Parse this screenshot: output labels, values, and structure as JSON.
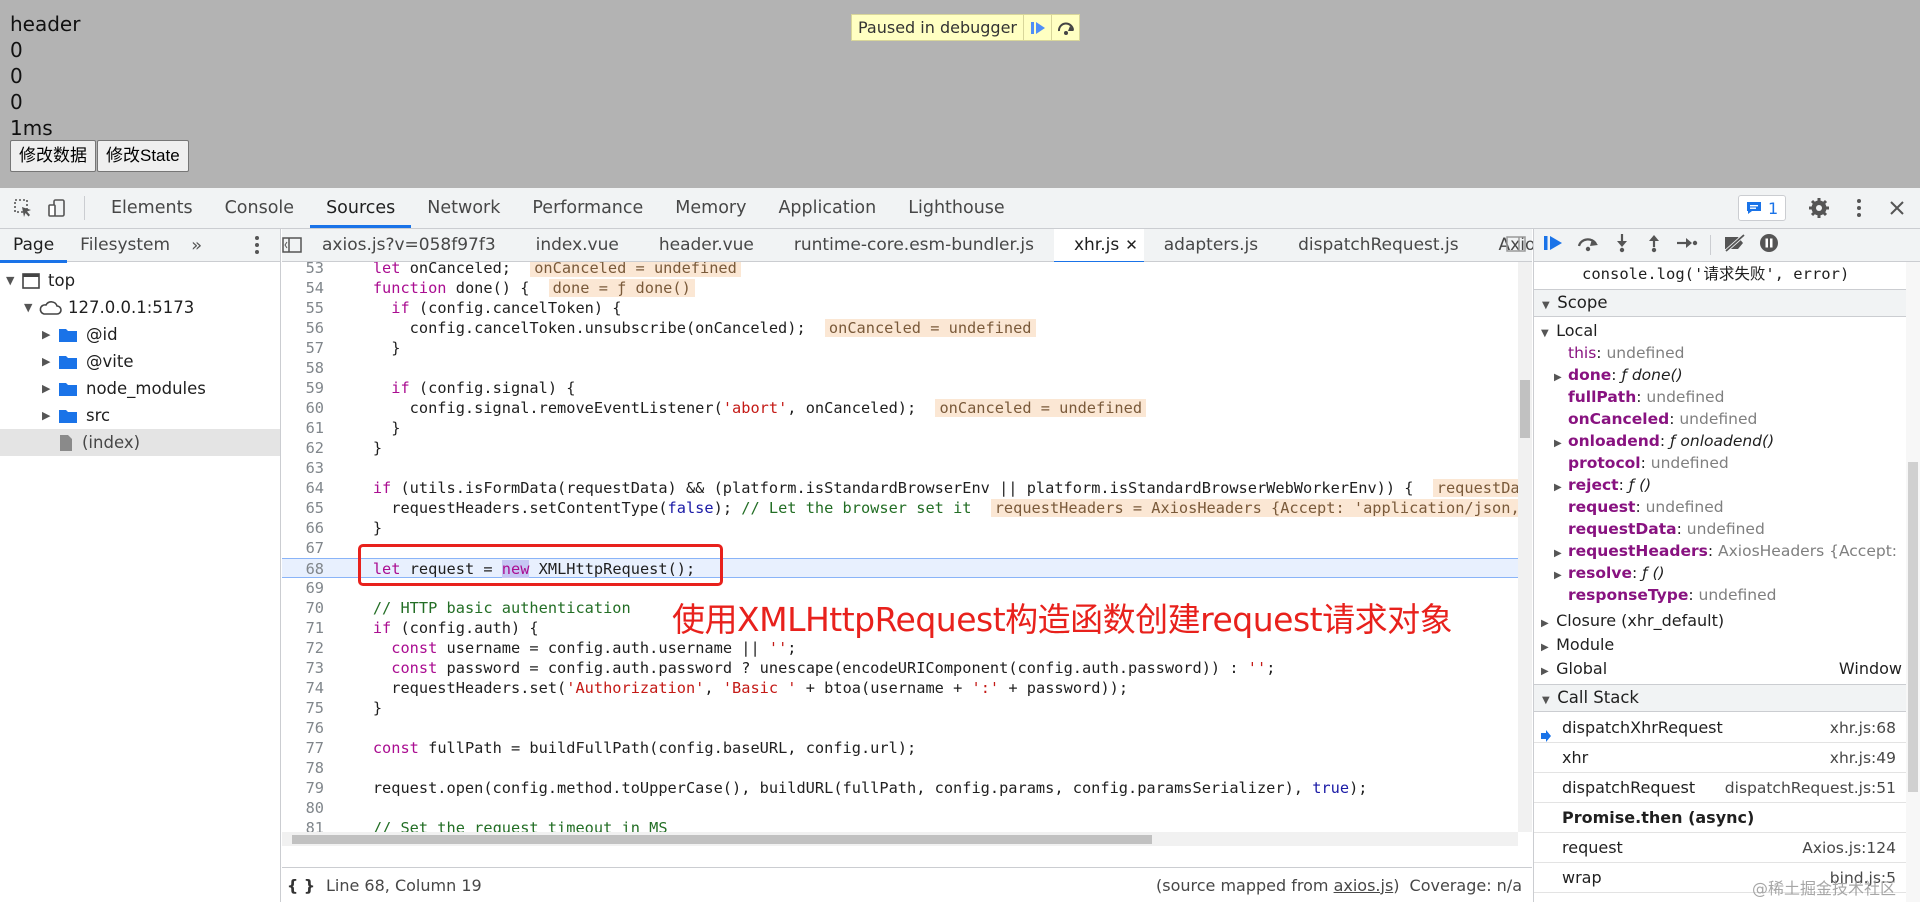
{
  "page": {
    "lines": [
      "header",
      "0",
      "0",
      "0",
      "1ms"
    ],
    "buttons": [
      "修改数据",
      "修改State"
    ],
    "paused_text": "Paused in debugger"
  },
  "devtools": {
    "tabs": [
      "Elements",
      "Console",
      "Sources",
      "Network",
      "Performance",
      "Memory",
      "Application",
      "Lighthouse"
    ],
    "active_tab": "Sources",
    "issues_count": "1"
  },
  "navigator": {
    "tabs": [
      "Page",
      "Filesystem"
    ],
    "tree": [
      {
        "label": "top",
        "type": "frame"
      },
      {
        "label": "127.0.0.1:5173",
        "type": "cloud"
      },
      {
        "label": "@id",
        "type": "folder"
      },
      {
        "label": "@vite",
        "type": "folder"
      },
      {
        "label": "node_modules",
        "type": "folder"
      },
      {
        "label": "src",
        "type": "folder"
      },
      {
        "label": "(index)",
        "type": "file"
      }
    ]
  },
  "editor": {
    "file_tabs": [
      "axios.js?v=058f97f3",
      "index.vue",
      "header.vue",
      "runtime-core.esm-bundler.js",
      "xhr.js",
      "adapters.js",
      "dispatchRequest.js",
      "Axios.js"
    ],
    "active_file": "xhr.js",
    "status": {
      "position": "Line 68, Column 19",
      "source_mapped": "(source mapped from ",
      "source_link": "axios.js",
      "source_close": ")",
      "coverage": "Coverage: n/a"
    },
    "annotation": "使用XMLHttpRequest构造函数创建request请求对象"
  },
  "debugger": {
    "console_line": "console.log('请求失败', error)",
    "scope_title": "Scope",
    "local_title": "Local",
    "locals": [
      {
        "name": "this",
        "value": "undefined",
        "expandable": false,
        "bold": false
      },
      {
        "name": "done",
        "value": "ƒ done()",
        "expandable": true,
        "bold": true
      },
      {
        "name": "fullPath",
        "value": "undefined",
        "expandable": false,
        "bold": true
      },
      {
        "name": "onCanceled",
        "value": "undefined",
        "expandable": false,
        "bold": true
      },
      {
        "name": "onloadend",
        "value": "ƒ onloadend()",
        "expandable": true,
        "bold": true
      },
      {
        "name": "protocol",
        "value": "undefined",
        "expandable": false,
        "bold": true
      },
      {
        "name": "reject",
        "value": "ƒ ()",
        "expandable": true,
        "bold": true
      },
      {
        "name": "request",
        "value": "undefined",
        "expandable": false,
        "bold": true
      },
      {
        "name": "requestData",
        "value": "undefined",
        "expandable": false,
        "bold": true
      },
      {
        "name": "requestHeaders",
        "value": "AxiosHeaders {Accept:",
        "expandable": true,
        "bold": true
      },
      {
        "name": "resolve",
        "value": "ƒ ()",
        "expandable": true,
        "bold": true
      },
      {
        "name": "responseType",
        "value": "undefined",
        "expandable": false,
        "bold": true
      }
    ],
    "closures": [
      "Closure (xhr_default)",
      "Module",
      "Global"
    ],
    "global_value": "Window",
    "callstack_title": "Call Stack",
    "callstack": [
      {
        "name": "dispatchXhrRequest",
        "loc": "xhr.js:68",
        "current": true
      },
      {
        "name": "xhr",
        "loc": "xhr.js:49",
        "current": false
      },
      {
        "name": "dispatchRequest",
        "loc": "dispatchRequest.js:51",
        "current": false
      },
      {
        "name": "Promise.then (async)",
        "loc": "",
        "async": true
      },
      {
        "name": "request",
        "loc": "Axios.js:124",
        "current": false
      },
      {
        "name": "wrap",
        "loc": "bind.js:5",
        "current": false
      }
    ]
  },
  "watermark": "@稀土掘金技术社区"
}
